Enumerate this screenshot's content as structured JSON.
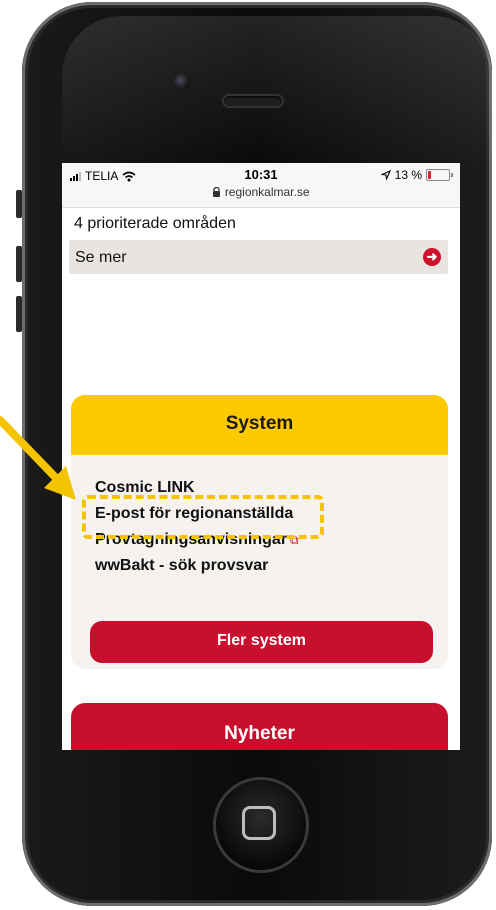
{
  "status_bar": {
    "carrier": "TELIA",
    "time": "10:31",
    "url": "regionkalmar.se",
    "battery_text": "13 %",
    "battery_level": 0.13,
    "battery_color": "#e0232a"
  },
  "content": {
    "section_title": "4 prioriterade områden",
    "se_mer_label": "Se mer",
    "se_mer_icon": "arrow-right-circle-icon"
  },
  "system_card": {
    "title": "System",
    "header_color": "#ffc900",
    "links": [
      {
        "label": "Cosmic LINK",
        "external": false
      },
      {
        "label": "E-post för regionanställda",
        "external": false,
        "highlighted": true
      },
      {
        "label": "Provtagningsanvisningar",
        "external": true,
        "icon": "external-link-icon"
      },
      {
        "label": "wwBakt - sök provsvar",
        "external": false
      }
    ],
    "button_label": "Fler system",
    "button_color": "#c8102e"
  },
  "news_card": {
    "title": "Nyheter",
    "color": "#c8102e"
  },
  "annotation": {
    "color": "#f5c400",
    "icon": "pointer-arrow-icon"
  }
}
